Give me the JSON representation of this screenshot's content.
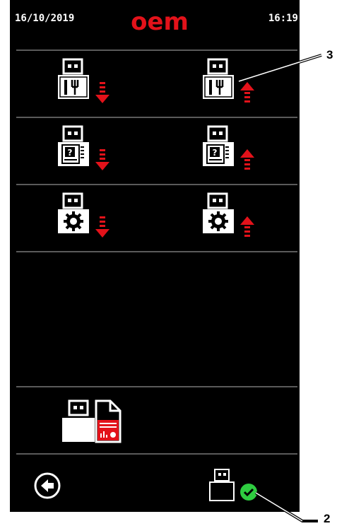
{
  "header": {
    "date": "16/10/2019",
    "brand": "oem",
    "time": "16:19"
  },
  "rows": [
    {
      "category": "recipes",
      "left_icon": "usb-recipes-import-icon",
      "right_icon": "usb-recipes-export-icon"
    },
    {
      "category": "manual",
      "left_icon": "usb-manual-import-icon",
      "right_icon": "usb-manual-export-icon"
    },
    {
      "category": "settings",
      "left_icon": "usb-settings-import-icon",
      "right_icon": "usb-settings-export-icon"
    }
  ],
  "report": {
    "icon": "usb-report-export-icon"
  },
  "footer": {
    "back_icon": "back-arrow-icon",
    "status_icon": "usb-connected-check-icon"
  },
  "callouts": {
    "top": "3",
    "bottom": "2"
  },
  "colors": {
    "accent": "#e3121a",
    "ok": "#2ecc40",
    "background": "#000000",
    "foreground": "#ffffff"
  }
}
